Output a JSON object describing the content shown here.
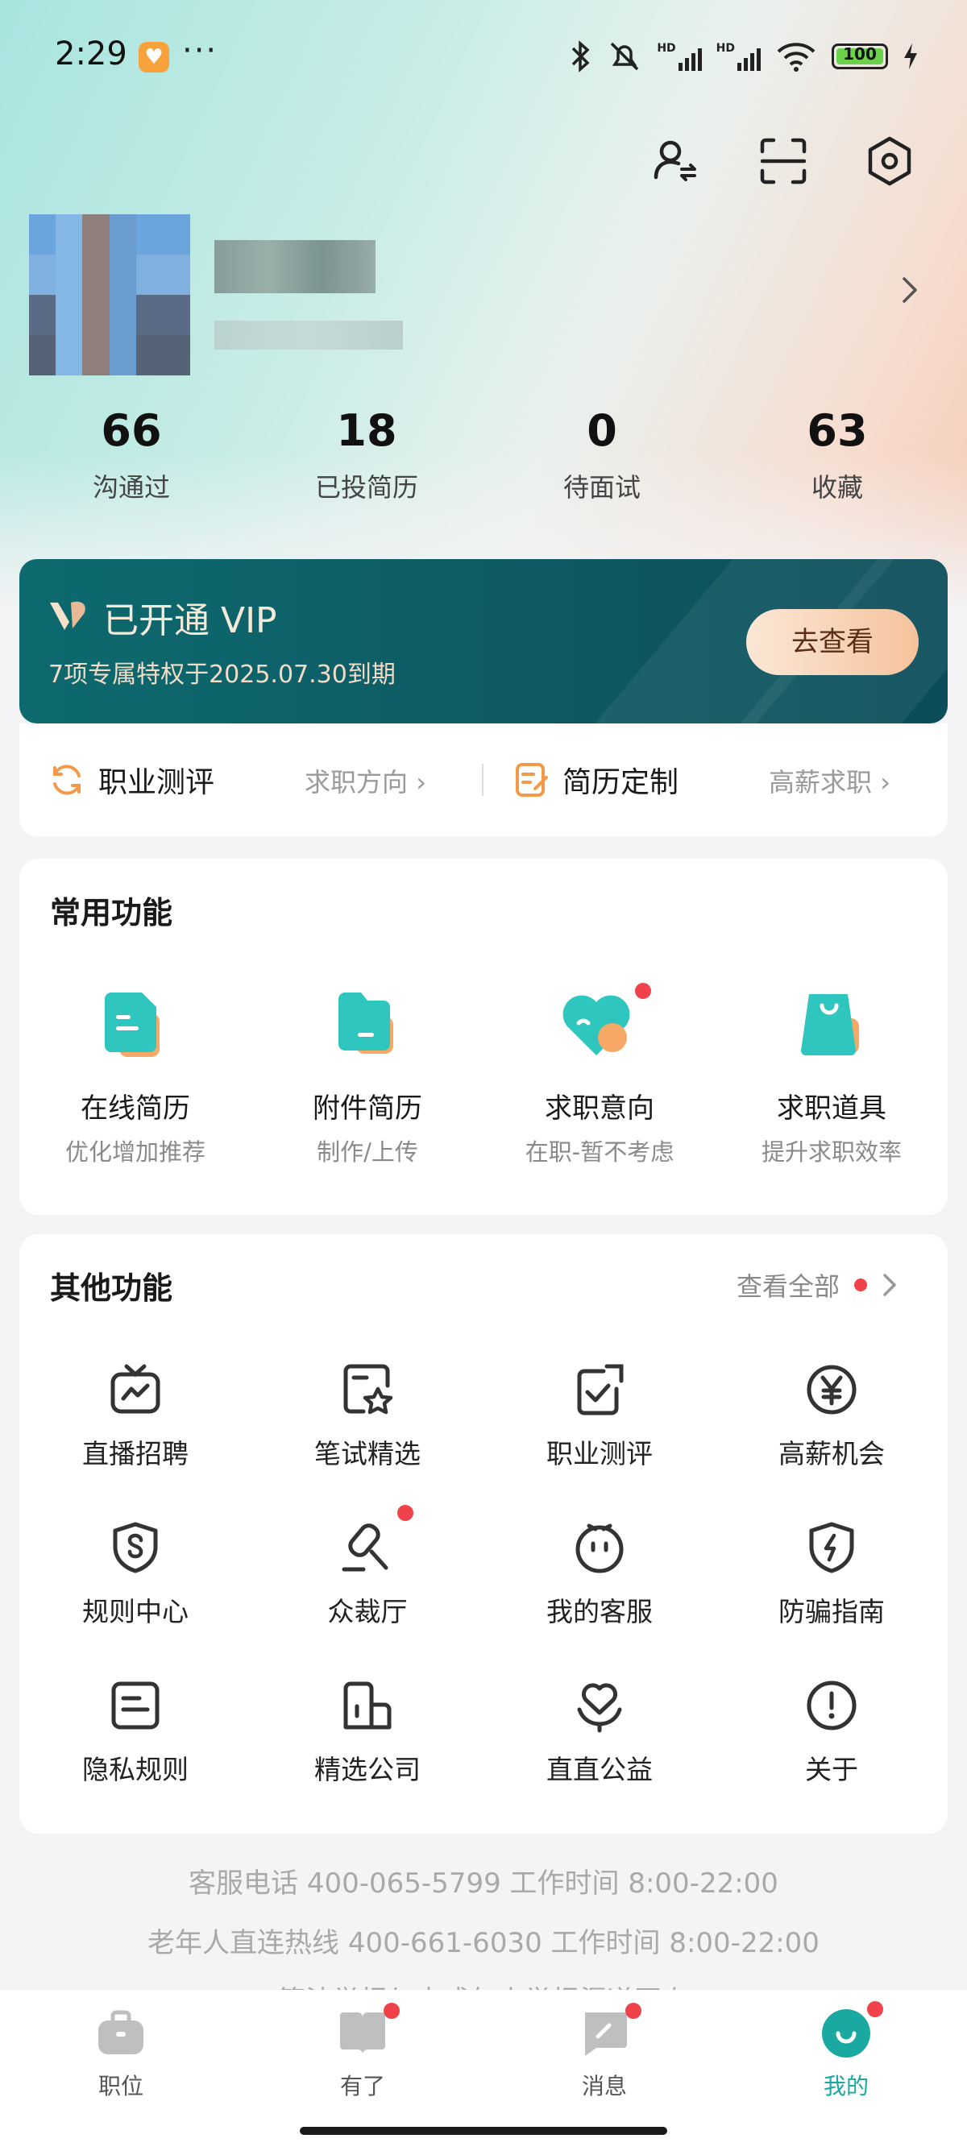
{
  "status_bar": {
    "time": "2:29",
    "more": "···",
    "battery": "100",
    "battery_level": 1.0
  },
  "header": {
    "icons": [
      "switch-identity-icon",
      "scan-icon",
      "settings-icon"
    ]
  },
  "stats": [
    {
      "value": "66",
      "label": "沟通过"
    },
    {
      "value": "18",
      "label": "已投简历"
    },
    {
      "value": "0",
      "label": "待面试"
    },
    {
      "value": "63",
      "label": "收藏"
    }
  ],
  "vip": {
    "title": "已开通 VIP",
    "subtitle": "7项专属特权于2025.07.30到期",
    "button": "去查看"
  },
  "quick_links": [
    {
      "title": "职业测评",
      "hint": "求职方向"
    },
    {
      "title": "简历定制",
      "hint": "高薪求职"
    }
  ],
  "common": {
    "title": "常用功能",
    "items": [
      {
        "label": "在线简历",
        "sub": "优化增加推荐"
      },
      {
        "label": "附件简历",
        "sub": "制作/上传"
      },
      {
        "label": "求职意向",
        "sub": "在职-暂不考虑"
      },
      {
        "label": "求职道具",
        "sub": "提升求职效率"
      }
    ]
  },
  "other": {
    "title": "其他功能",
    "see_all": "查看全部",
    "items": [
      {
        "label": "直播招聘",
        "icon": "tv-icon"
      },
      {
        "label": "笔试精选",
        "icon": "star-doc-icon"
      },
      {
        "label": "职业测评",
        "icon": "check-doc-icon"
      },
      {
        "label": "高薪机会",
        "icon": "yen-icon"
      },
      {
        "label": "规则中心",
        "icon": "shield-s-icon"
      },
      {
        "label": "众裁厅",
        "icon": "gavel-icon"
      },
      {
        "label": "我的客服",
        "icon": "service-face-icon"
      },
      {
        "label": "防骗指南",
        "icon": "shield-bolt-icon"
      },
      {
        "label": "隐私规则",
        "icon": "privacy-doc-icon"
      },
      {
        "label": "精选公司",
        "icon": "building-icon"
      },
      {
        "label": "直直公益",
        "icon": "heart-hand-icon"
      },
      {
        "label": "关于",
        "icon": "info-icon"
      }
    ]
  },
  "footer": {
    "line1": "客服电话 400-065-5799  工作时间 8:00-22:00",
    "line2": "老年人直连热线 400-661-6030 工作时间 8:00-22:00",
    "line3": "算法举报与未成年人举报渠道同上"
  },
  "tabs": [
    {
      "label": "职位",
      "active": false
    },
    {
      "label": "有了",
      "active": false
    },
    {
      "label": "消息",
      "active": false
    },
    {
      "label": "我的",
      "active": true
    }
  ],
  "colors": {
    "accent": "#1aa9a0",
    "vip_bg": "#0d6a6f",
    "red_dot": "#f0424b"
  }
}
